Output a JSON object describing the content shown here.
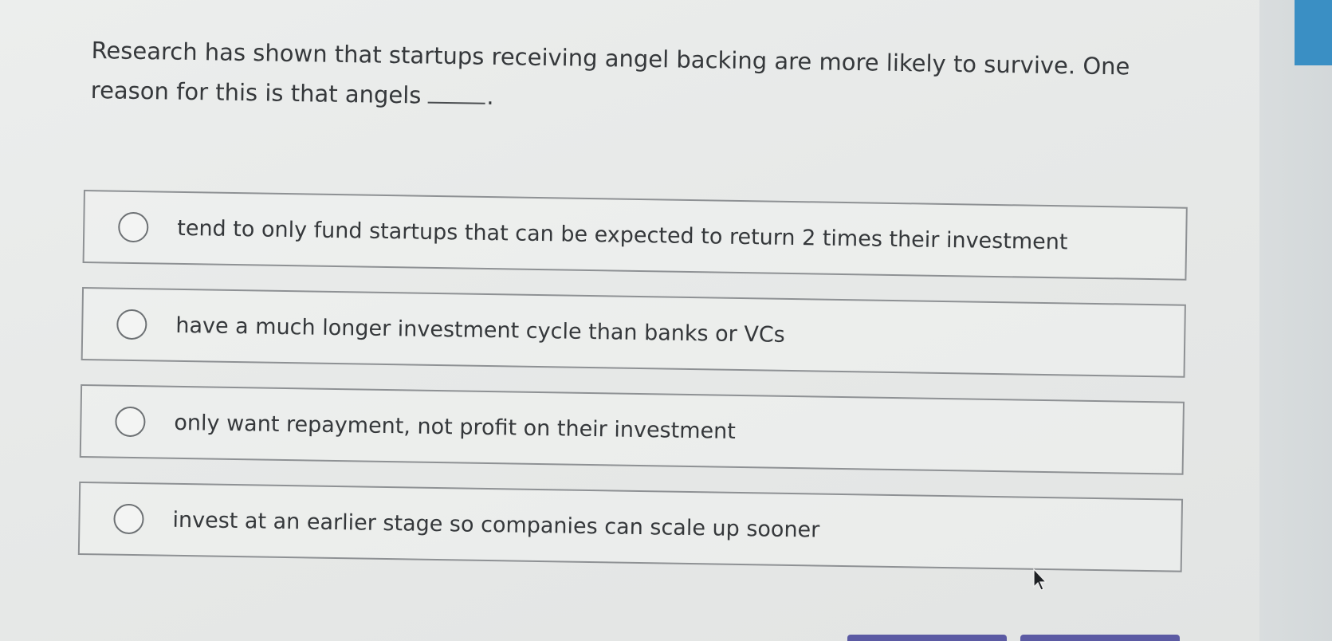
{
  "question": {
    "text": "Research has shown that startups receiving angel backing are more likely to survive. One reason for this is that angels",
    "blank": "_____",
    "end": "."
  },
  "options": [
    {
      "label": "tend to only fund startups that can be expected to return 2 times their investment",
      "selected": false
    },
    {
      "label": "have a much longer investment cycle than banks or VCs",
      "selected": false
    },
    {
      "label": "only want repayment, not profit on their investment",
      "selected": false
    },
    {
      "label": "invest at an earlier stage so companies can scale up sooner",
      "selected": false
    }
  ],
  "colors": {
    "accent": "#3a8fc4",
    "button": "#5b5aa3",
    "text": "#35383b"
  }
}
